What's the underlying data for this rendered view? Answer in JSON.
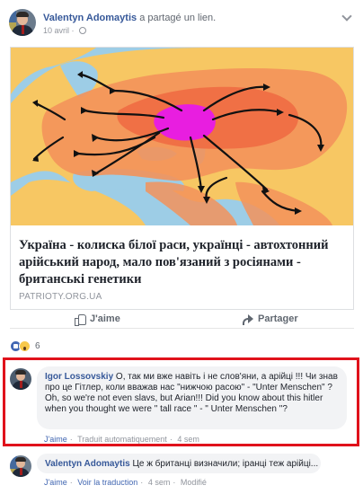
{
  "post": {
    "author": "Valentyn Adomaytis",
    "action": "a partagé un lien.",
    "date": "10 avril",
    "separator": "·"
  },
  "link": {
    "title": "Україна - колиска білої раси, українці - автохтонний арійський народ, мало пов'язаний з росіянами - британські генетики",
    "domain": "PATRIOTY.ORG.UA"
  },
  "actions": {
    "like_label": "J'aime",
    "share_label": "Partager"
  },
  "reactions": {
    "count": "6"
  },
  "comments": [
    {
      "author": "Igor Lossovskiy",
      "text": "О, так ми вже навіть і не слов'яни, а арійці !!! Чи знав про це Гітлер, коли вважав нас \"нижчою расою\" - \"Unter Menschen\" ?\nOh, so we're not even slavs, but Arian!!! Did you know about this hitler when you thought we were \" tall race \" - \" Unter Menschen \"?",
      "like": "J'aime",
      "translate": "Traduit automatiquement",
      "time": "4 sem"
    },
    {
      "author": "Valentyn Adomaytis",
      "text": "Це ж британці визначили; іранці теж арійці...",
      "like": "J'aime",
      "translate": "Voir la traduction",
      "time": "4 sem",
      "edited": "Modifié"
    }
  ],
  "colors": {
    "link_blue": "#365899",
    "highlight_red": "#e0121b",
    "map_sea": "#9dcde6",
    "map_land": "#f7c763",
    "map_orange": "#f3925a",
    "map_core": "#e81ee0"
  }
}
